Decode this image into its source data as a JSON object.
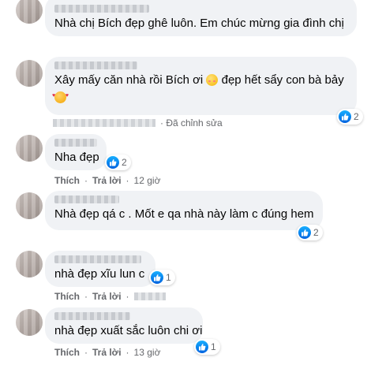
{
  "comments": [
    {
      "text": "Nhà chị Bích đẹp ghê luôn. Em chúc mừng gia đình chị"
    },
    {
      "text": "Xây mấy căn nhà rồi Bích ơi",
      "text_tail": "đẹp hết sẩy con bà bảy",
      "emoji1": "flushed-face-emoji",
      "emoji2": "smiling-face-with-hearts-emoji",
      "reaction_count": "2",
      "edited_label": "· Đã chỉnh sửa"
    },
    {
      "text": "Nha đẹp",
      "reaction_count": "2",
      "like_label": "Thích",
      "reply_label": "Trả lời",
      "time": "12 giờ"
    },
    {
      "text": "Nhà đẹp qá c . Mốt e qa nhà này làm c đúng hem",
      "reaction_count": "2"
    },
    {
      "text": "nhà đẹp xĩu lun c",
      "reaction_count": "1",
      "like_label": "Thích",
      "reply_label": "Trả lời",
      "time": "1 giờ"
    },
    {
      "text": "nhà đẹp xuất sắc luôn chi ơi",
      "reaction_count": "1",
      "like_label": "Thích",
      "reply_label": "Trả lời",
      "time": "13 giờ"
    }
  ],
  "colors": {
    "bubble": "#f0f2f5",
    "like_blue": "#1877f2",
    "meta": "#65676b"
  }
}
